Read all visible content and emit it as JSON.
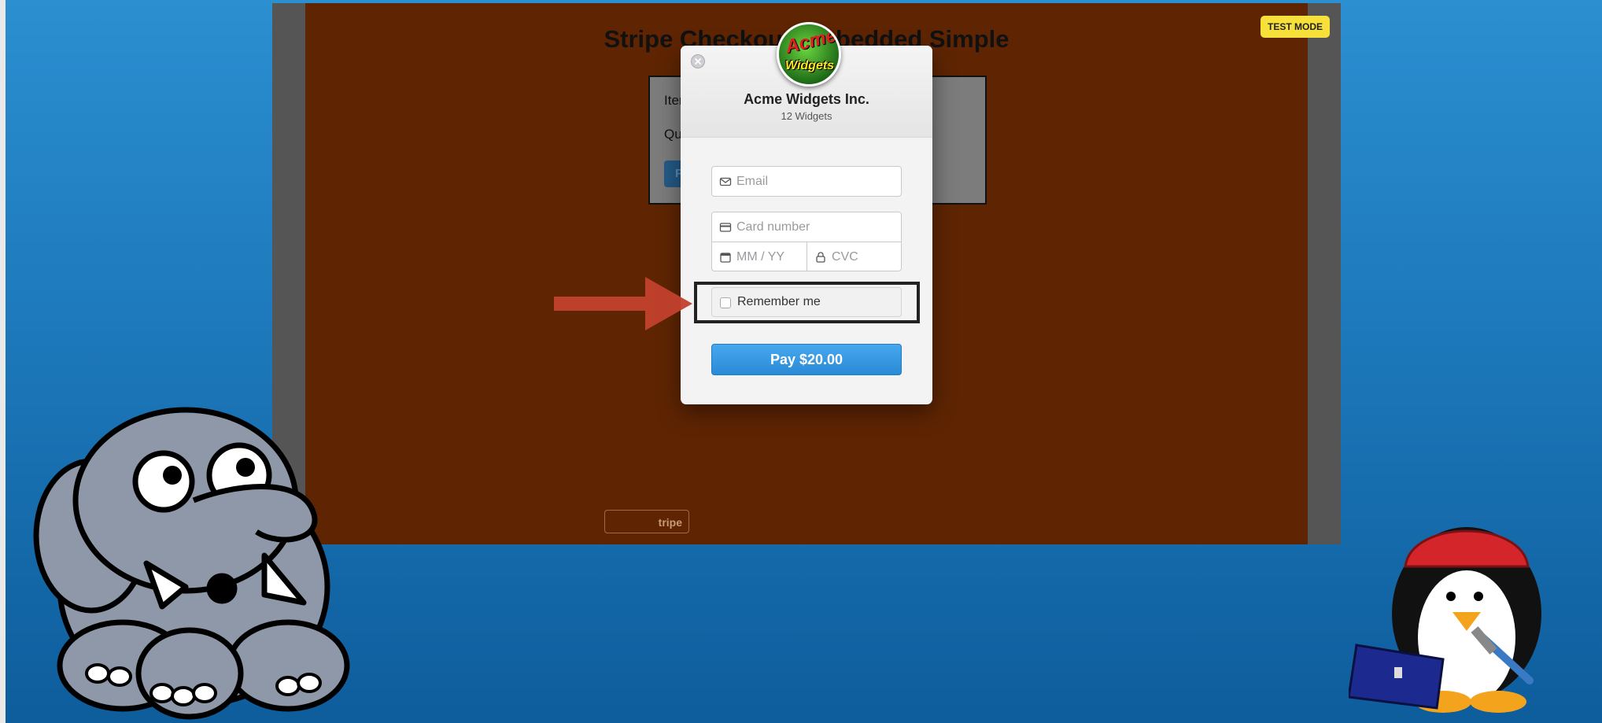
{
  "page": {
    "title": "Stripe Checkout Embedded Simple",
    "test_badge": "TEST MODE",
    "order": {
      "item_label": "Item",
      "quantity_label": "Qua",
      "pay_button_fragment": "Pa"
    },
    "stripe_badge": "tripe",
    "background_color": "#5f2503"
  },
  "checkout": {
    "merchant_name": "Acme Widgets Inc.",
    "description": "12 Widgets",
    "logo": {
      "top_text": "Acme",
      "bottom_text": "Widgets"
    },
    "fields": {
      "email_placeholder": "Email",
      "card_placeholder": "Card number",
      "expiry_placeholder": "MM / YY",
      "cvc_placeholder": "CVC"
    },
    "remember_label": "Remember me",
    "remember_checked": false,
    "pay_button": "Pay $20.00",
    "accent_color": "#2a8ad6"
  },
  "decorations": {
    "arrow_color": "#c2412d",
    "icons": [
      "close-icon",
      "envelope-icon",
      "credit-card-icon",
      "calendar-icon",
      "lock-icon",
      "elephant-cartoon",
      "penguin-cartoon"
    ]
  }
}
